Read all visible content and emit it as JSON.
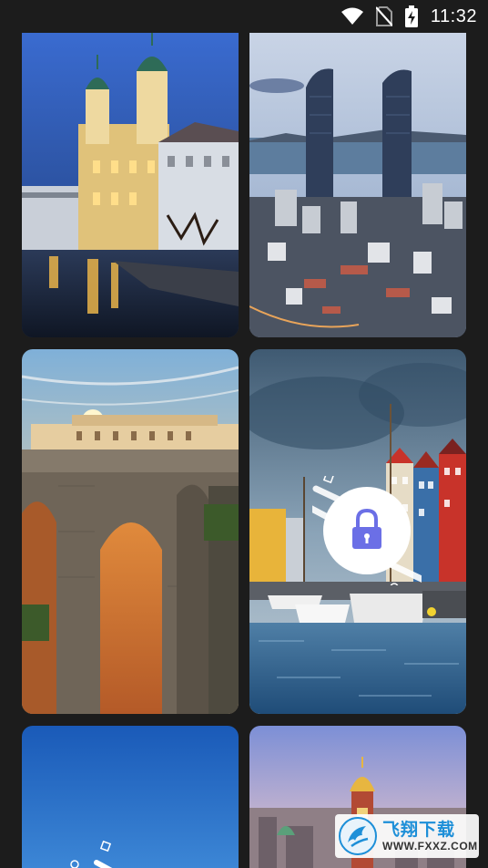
{
  "status_bar": {
    "time": "11:32",
    "icons": [
      "wifi-icon",
      "no-sim-icon",
      "battery-charging-icon"
    ]
  },
  "wallpapers": [
    {
      "id": 1,
      "subject": "baroque church at night by the water",
      "locked": false
    },
    {
      "id": 2,
      "subject": "twin skyscrapers over coastal city",
      "locked": false
    },
    {
      "id": 3,
      "subject": "stone arch bridge at sunset",
      "locked": false
    },
    {
      "id": 4,
      "subject": "colorful harbor houses with boats",
      "locked": true
    },
    {
      "id": 5,
      "subject": "blue sky",
      "locked": false
    },
    {
      "id": 6,
      "subject": "golden dome tower over city",
      "locked": false
    }
  ],
  "lock_overlay": {
    "icon": "padlock-icon",
    "color": "#6b6fe6"
  },
  "watermark": {
    "title": "飞翔下载",
    "domain": "WWW.FXXZ.COM"
  },
  "colors": {
    "background": "#1c1c1c",
    "lock_accent": "#6b6fe6"
  }
}
